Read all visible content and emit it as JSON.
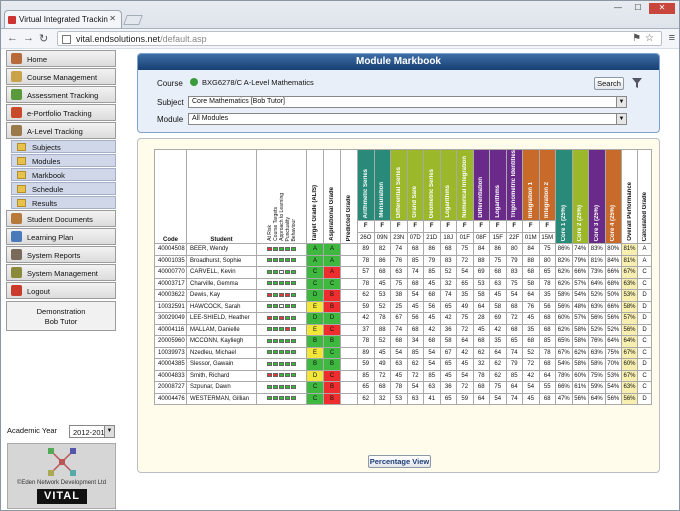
{
  "browser": {
    "tab_title": "Virtual Integrated Trackin",
    "url_host": "vital.endsolutions.net",
    "url_path": "/default.asp"
  },
  "sidebar": {
    "items": [
      {
        "label": "Home",
        "icon": "home-icon",
        "color": "#b86b3a"
      },
      {
        "label": "Course Management",
        "icon": "course-icon",
        "color": "#c9a24b"
      },
      {
        "label": "Assessment Tracking",
        "icon": "assessment-icon",
        "color": "#5a9a3a"
      },
      {
        "label": "e-Portfolio Tracking",
        "icon": "portfolio-icon",
        "color": "#c94a2a"
      },
      {
        "label": "A-Level Tracking",
        "icon": "alevel-icon",
        "color": "#9a7a4a"
      }
    ],
    "subitems": [
      "Subjects",
      "Modules",
      "Markbook",
      "Schedule",
      "Results"
    ],
    "items2": [
      {
        "label": "Student Documents",
        "icon": "documents-icon",
        "color": "#b87a3a"
      },
      {
        "label": "Learning Plan",
        "icon": "learning-plan-icon",
        "color": "#4a7aba"
      },
      {
        "label": "System Reports",
        "icon": "reports-icon",
        "color": "#7a6a5a"
      },
      {
        "label": "System Management",
        "icon": "management-icon",
        "color": "#8a8a3a"
      },
      {
        "label": "Logout",
        "icon": "power-icon",
        "color": "#c93a2a"
      }
    ],
    "user_line1": "Demonstration",
    "user_line2": "Bob Tutor",
    "academic_year_label": "Academic Year",
    "academic_year_value": "2012-2013",
    "copyright": "©Eden Network Development Ltd",
    "brand": "VITAL"
  },
  "panel": {
    "title": "Module Markbook",
    "course_label": "Course",
    "course_value": "BXG6278/C A-Level Mathematics",
    "search_label": "Search",
    "subject_label": "Subject",
    "subject_value": "Core Mathematics [Bob Tutor]",
    "module_label": "Module",
    "module_value": "All Modules"
  },
  "table": {
    "code_header": "Code",
    "student_header": "Student",
    "mini_headers": [
      "At Risk",
      "Course Targets",
      "Approach to Learning",
      "Punctuality",
      "Behaviour"
    ],
    "target_header": "Target Grade (ALIS)",
    "aspirational_header": "Aspirational Grade",
    "predicted_header": "Predicted Grade",
    "modules": [
      {
        "name": "Arithmetic Series",
        "code": "26O",
        "color": "#2a8a7a"
      },
      {
        "name": "Mensuration",
        "code": "09N",
        "color": "#2a8a7a"
      },
      {
        "name": "Differential Series",
        "code": "23N",
        "color": "#9ab82a"
      },
      {
        "name": "Grand Sale",
        "code": "07D",
        "color": "#9ab82a"
      },
      {
        "name": "Geometric Series",
        "code": "21D",
        "color": "#9ab82a"
      },
      {
        "name": "Logarithms",
        "code": "18J",
        "color": "#9ab82a"
      },
      {
        "name": "Numerical Integration",
        "code": "01F",
        "color": "#9ab82a"
      },
      {
        "name": "Differentiation",
        "code": "08F",
        "color": "#6a2a8a"
      },
      {
        "name": "Logarithms",
        "code": "15F",
        "color": "#6a2a8a"
      },
      {
        "name": "Trigonometric Identities",
        "code": "22F",
        "color": "#6a2a8a"
      },
      {
        "name": "Integration 1",
        "code": "01M",
        "color": "#c86a2a"
      },
      {
        "name": "Integration 2",
        "code": "15M",
        "color": "#c86a2a"
      }
    ],
    "cores": [
      {
        "name": "Core 1 (25%)",
        "color": "#2a8a7a"
      },
      {
        "name": "Core 2 (25%)",
        "color": "#9ab82a"
      },
      {
        "name": "Core 3 (25%)",
        "color": "#6a2a8a"
      },
      {
        "name": "Core 4 (25%)",
        "color": "#c86a2a"
      }
    ],
    "overall_header": "Overall Performance",
    "calculated_header": "Calculated Grade",
    "f_label": "F",
    "rows": [
      {
        "code": "40004508",
        "name": "BEER, Wendy",
        "bar": [
          "r",
          "g",
          "g",
          "g",
          "g"
        ],
        "tg": "A",
        "ag": "A",
        "tgc": "ga",
        "agc": "ga",
        "marks": [
          "89",
          "82",
          "74",
          "68",
          "86",
          "68",
          "75",
          "84",
          "86",
          "80",
          "84",
          "75"
        ],
        "cores": [
          "86%",
          "74%",
          "83%",
          "80%"
        ],
        "overall": "81%",
        "calc": "A"
      },
      {
        "code": "40001035",
        "name": "Broadhurst, Sophie",
        "bar": [
          "g",
          "g",
          "g",
          "g",
          "g"
        ],
        "tg": "A",
        "ag": "A",
        "tgc": "ga",
        "agc": "ga",
        "marks": [
          "78",
          "86",
          "76",
          "85",
          "79",
          "83",
          "72",
          "88",
          "75",
          "79",
          "88",
          "80"
        ],
        "cores": [
          "82%",
          "79%",
          "81%",
          "84%",
          "81%"
        ],
        "overall": "81%",
        "calc": "A"
      },
      {
        "code": "40000770",
        "name": "CARVELL, Kevin",
        "bar": [
          "g",
          "g",
          "w",
          "g",
          "g"
        ],
        "tg": "C",
        "ag": "A",
        "tgc": "ga",
        "agc": "gb",
        "marks": [
          "57",
          "68",
          "63",
          "74",
          "85",
          "52",
          "54",
          "69",
          "68",
          "83",
          "68",
          "65"
        ],
        "cores": [
          "62%",
          "66%",
          "73%",
          "66%"
        ],
        "overall": "67%",
        "calc": "C"
      },
      {
        "code": "40003717",
        "name": "Charville, Gemma",
        "bar": [
          "g",
          "g",
          "g",
          "g",
          "g"
        ],
        "tg": "C",
        "ag": "C",
        "tgc": "ga",
        "agc": "ga",
        "marks": [
          "78",
          "45",
          "75",
          "68",
          "45",
          "32",
          "65",
          "53",
          "63",
          "75",
          "58",
          "78"
        ],
        "cores": [
          "62%",
          "57%",
          "64%",
          "68%"
        ],
        "overall": "63%",
        "calc": "C"
      },
      {
        "code": "40003622",
        "name": "Dewis, Kay",
        "bar": [
          "r",
          "g",
          "r",
          "r",
          "g"
        ],
        "tg": "D",
        "ag": "B",
        "tgc": "ga",
        "agc": "gb",
        "marks": [
          "62",
          "53",
          "38",
          "54",
          "68",
          "74",
          "35",
          "58",
          "45",
          "54",
          "64",
          "35"
        ],
        "cores": [
          "58%",
          "54%",
          "52%",
          "50%"
        ],
        "overall": "53%",
        "calc": "D"
      },
      {
        "code": "10032591",
        "name": "HAWCOCK, Sarah",
        "bar": [
          "g",
          "g",
          "w",
          "g",
          "g"
        ],
        "tg": "E",
        "ag": "B",
        "tgc": "gc",
        "agc": "gb",
        "marks": [
          "59",
          "52",
          "25",
          "45",
          "56",
          "65",
          "49",
          "64",
          "58",
          "68",
          "76",
          "56"
        ],
        "cores": [
          "56%",
          "48%",
          "63%",
          "66%"
        ],
        "overall": "58%",
        "calc": "D"
      },
      {
        "code": "30029049",
        "name": "LEE-SHIELD, Heather",
        "bar": [
          "r",
          "g",
          "r",
          "g",
          "g"
        ],
        "tg": "D",
        "ag": "D",
        "tgc": "ga",
        "agc": "ga",
        "marks": [
          "42",
          "78",
          "67",
          "56",
          "45",
          "42",
          "75",
          "28",
          "69",
          "72",
          "45",
          "68"
        ],
        "cores": [
          "60%",
          "57%",
          "56%",
          "56%"
        ],
        "overall": "57%",
        "calc": "D"
      },
      {
        "code": "40004116",
        "name": "MALLAM, Danielle",
        "bar": [
          "g",
          "g",
          "g",
          "r",
          "g"
        ],
        "tg": "E",
        "ag": "C",
        "tgc": "gc",
        "agc": "gb",
        "marks": [
          "37",
          "88",
          "74",
          "68",
          "42",
          "36",
          "72",
          "45",
          "42",
          "68",
          "35",
          "68"
        ],
        "cores": [
          "62%",
          "58%",
          "52%",
          "52%"
        ],
        "overall": "56%",
        "calc": "D"
      },
      {
        "code": "20005960",
        "name": "MCCONN, Kayliegh",
        "bar": [
          "g",
          "g",
          "g",
          "g",
          "g"
        ],
        "tg": "B",
        "ag": "B",
        "tgc": "ga",
        "agc": "ga",
        "marks": [
          "78",
          "52",
          "68",
          "34",
          "68",
          "58",
          "64",
          "68",
          "35",
          "65",
          "68",
          "85"
        ],
        "cores": [
          "65%",
          "58%",
          "76%",
          "64%"
        ],
        "overall": "64%",
        "calc": "C"
      },
      {
        "code": "10039973",
        "name": "Nzedleu, Michael",
        "bar": [
          "g",
          "g",
          "g",
          "g",
          "g"
        ],
        "tg": "E",
        "ag": "C",
        "tgc": "gc",
        "agc": "ga",
        "marks": [
          "89",
          "45",
          "54",
          "85",
          "54",
          "67",
          "42",
          "62",
          "64",
          "74",
          "52",
          "78"
        ],
        "cores": [
          "67%",
          "62%",
          "63%",
          "75%"
        ],
        "overall": "67%",
        "calc": "C"
      },
      {
        "code": "40004385",
        "name": "Slessor, Gawain",
        "bar": [
          "g",
          "g",
          "g",
          "g",
          "g"
        ],
        "tg": "B",
        "ag": "B",
        "tgc": "ga",
        "agc": "ga",
        "marks": [
          "59",
          "49",
          "63",
          "62",
          "54",
          "65",
          "45",
          "32",
          "62",
          "79",
          "72",
          "68"
        ],
        "cores": [
          "54%",
          "58%",
          "58%",
          "70%"
        ],
        "overall": "60%",
        "calc": "D"
      },
      {
        "code": "40004833",
        "name": "Smith, Richard",
        "bar": [
          "r",
          "r",
          "g",
          "g",
          "g"
        ],
        "tg": "D",
        "ag": "C",
        "tgc": "gc",
        "agc": "gb",
        "marks": [
          "85",
          "72",
          "45",
          "72",
          "85",
          "45",
          "54",
          "78",
          "62",
          "85",
          "42",
          "64"
        ],
        "cores": [
          "78%",
          "60%",
          "75%",
          "53%"
        ],
        "overall": "67%",
        "calc": "C"
      },
      {
        "code": "20008727",
        "name": "Szpunar, Dawn",
        "bar": [
          "g",
          "g",
          "g",
          "g",
          "g"
        ],
        "tg": "C",
        "ag": "B",
        "tgc": "ga",
        "agc": "gb",
        "marks": [
          "65",
          "68",
          "78",
          "54",
          "63",
          "36",
          "72",
          "68",
          "75",
          "64",
          "54",
          "55"
        ],
        "cores": [
          "66%",
          "61%",
          "59%",
          "54%"
        ],
        "overall": "63%",
        "calc": "C"
      },
      {
        "code": "40004476",
        "name": "WESTERMAN, Gillian",
        "bar": [
          "g",
          "g",
          "g",
          "g",
          "g"
        ],
        "tg": "C",
        "ag": "B",
        "tgc": "ga",
        "agc": "gb",
        "marks": [
          "62",
          "32",
          "53",
          "63",
          "41",
          "65",
          "59",
          "64",
          "54",
          "74",
          "45",
          "68"
        ],
        "cores": [
          "47%",
          "56%",
          "64%",
          "56%"
        ],
        "overall": "56%",
        "calc": "D"
      }
    ],
    "percentage_view_label": "Percentage View"
  }
}
